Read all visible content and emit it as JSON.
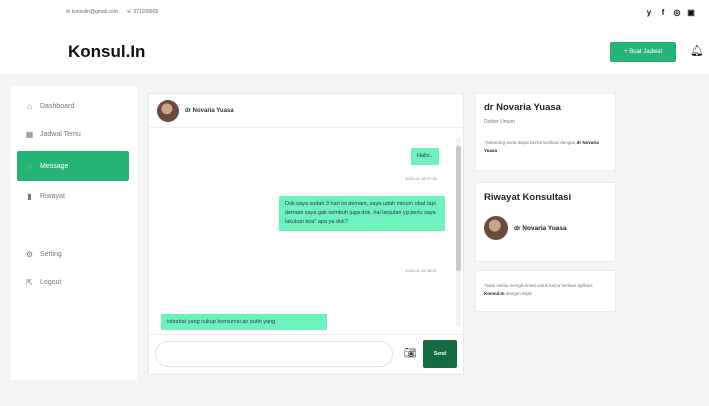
{
  "topbar": {
    "email": "konsulin@gmail.com",
    "phone": "071108909",
    "socials": [
      {
        "icon": "twitter-icon",
        "glyph": "y"
      },
      {
        "icon": "facebook-icon",
        "glyph": "f"
      },
      {
        "icon": "instagram-icon",
        "glyph": "◎"
      },
      {
        "icon": "linkedin-icon",
        "glyph": "▣"
      }
    ]
  },
  "header": {
    "logo": "Konsul.In",
    "create_button": "+ Buat Jadwal",
    "bell_icon": "bell-icon"
  },
  "sidebar": {
    "items": [
      {
        "label": "Dashboard",
        "icon": "home-icon",
        "glyph": "⌂",
        "active": false
      },
      {
        "label": "Jadwal Temu",
        "icon": "calendar-icon",
        "glyph": "▦",
        "active": false
      },
      {
        "label": "Message",
        "icon": "chat-icon",
        "glyph": "◌",
        "active": true
      },
      {
        "label": "Riwayat",
        "icon": "bookmark-icon",
        "glyph": "▮",
        "active": false
      },
      {
        "label": "Setting",
        "icon": "gear-icon",
        "glyph": "⚙",
        "active": false
      },
      {
        "label": "Logout",
        "icon": "logout-icon",
        "glyph": "⇱",
        "active": false
      }
    ]
  },
  "chat": {
    "contact_name": "dr Novaria Yuasa",
    "messages": [
      {
        "text": "Hallo..",
        "timestamp": "2020-01-18 07:15"
      },
      {
        "text": "Dok saya sudah 3 hari ini demam, saya udah minum obat tapi demam saya gak sembuh juga dok. hal lanjutan yg perlu saya lakukan kira\" apa ya dok?",
        "timestamp": "2020-01-18 08:10"
      },
      {
        "text": "istirahat yang cukup konsumsi air putih yang",
        "timestamp": ""
      }
    ],
    "input_placeholder": "",
    "send_label": "Send",
    "camera_icon": "camera-icon"
  },
  "doctor_card": {
    "name": "dr Novaria Yuasa",
    "role": "Dokter Umum",
    "note_prefix": "*Sekarang anda dapat berkomunikasi dengan",
    "note_name": "dr Novaria Yuasa"
  },
  "history_card": {
    "title": "Riwayat Konsultasi",
    "items": [
      {
        "name": "dr Novaria Yuasa"
      }
    ]
  },
  "info_card": {
    "text_prefix": "*kami selalu menghormati untuk kamu berikan aplikasi",
    "brand": "Konsul.In",
    "text_suffix": "dengan Bijak"
  }
}
